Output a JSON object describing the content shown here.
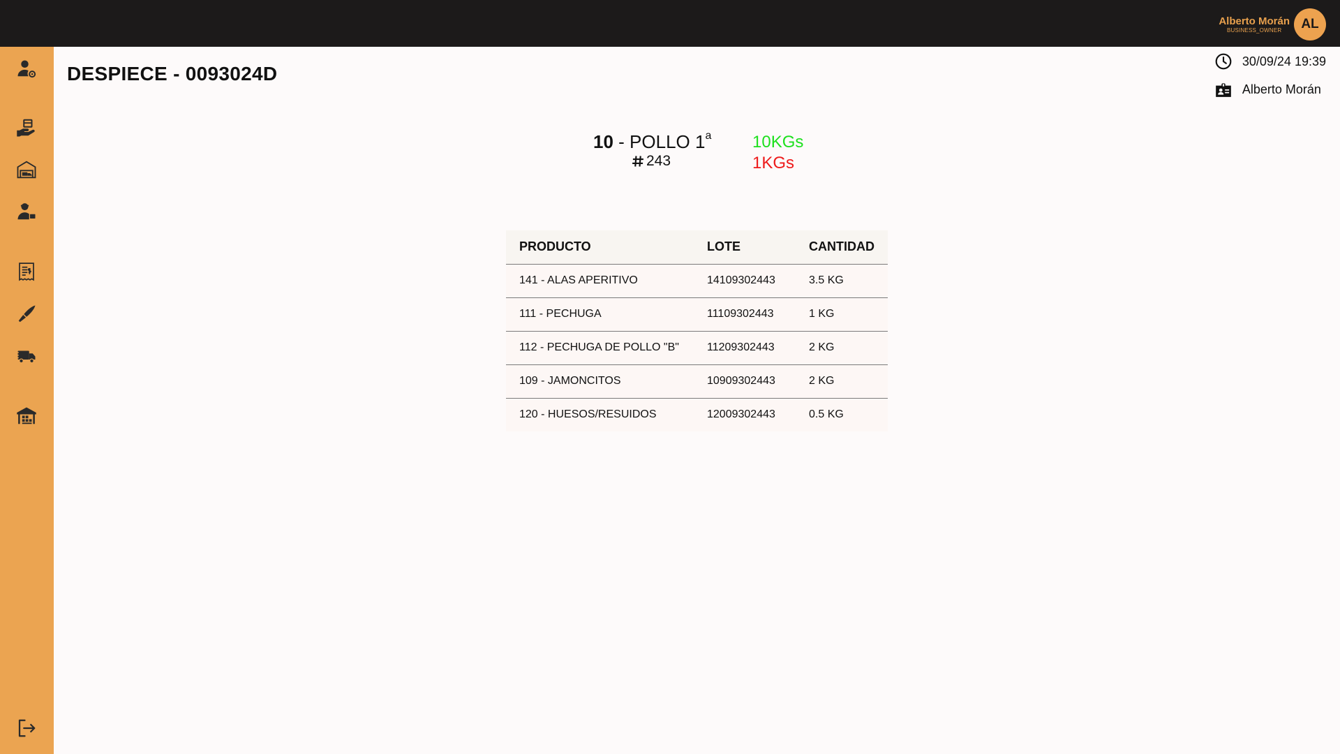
{
  "header": {
    "user_name": "Alberto Morán",
    "user_role": "BUSINESS_OWNER",
    "avatar_initials": "AL",
    "bar_color": "#1c1a1a",
    "accent_color": "#eba451"
  },
  "sidebar": {
    "items": [
      {
        "icon": "user-settings-icon"
      },
      {
        "icon": "hand-package-icon"
      },
      {
        "icon": "warehouse-truck-icon"
      },
      {
        "icon": "delivery-person-icon"
      },
      {
        "icon": "invoice-receipt-icon"
      },
      {
        "icon": "knife-icon"
      },
      {
        "icon": "delivery-truck-icon"
      },
      {
        "icon": "warehouse-icon"
      },
      {
        "icon": "logout-icon"
      }
    ]
  },
  "page": {
    "title": "DESPIECE - 0093024D",
    "datetime": "30/09/24 19:39",
    "operator": "Alberto Morán"
  },
  "summary": {
    "product_code": "10",
    "product_name": "- POLLO 1",
    "product_suffix": "a",
    "lot_number": "243",
    "weight_primary": "10KGs",
    "weight_secondary": "1KGs",
    "color_primary": "#1ee01e",
    "color_secondary": "#ee1b1b"
  },
  "table": {
    "headers": {
      "producto": "PRODUCTO",
      "lote": "LOTE",
      "cantidad": "CANTIDAD"
    },
    "rows": [
      {
        "producto": "141 - ALAS APERITIVO",
        "lote": "14109302443",
        "cantidad": "3.5 KG"
      },
      {
        "producto": "111 - PECHUGA",
        "lote": "11109302443",
        "cantidad": "1 KG"
      },
      {
        "producto": "112 - PECHUGA DE POLLO \"B\"",
        "lote": "11209302443",
        "cantidad": "2 KG"
      },
      {
        "producto": "109 - JAMONCITOS",
        "lote": "10909302443",
        "cantidad": "2 KG"
      },
      {
        "producto": "120 - HUESOS/RESUIDOS",
        "lote": "12009302443",
        "cantidad": "0.5 KG"
      }
    ]
  }
}
